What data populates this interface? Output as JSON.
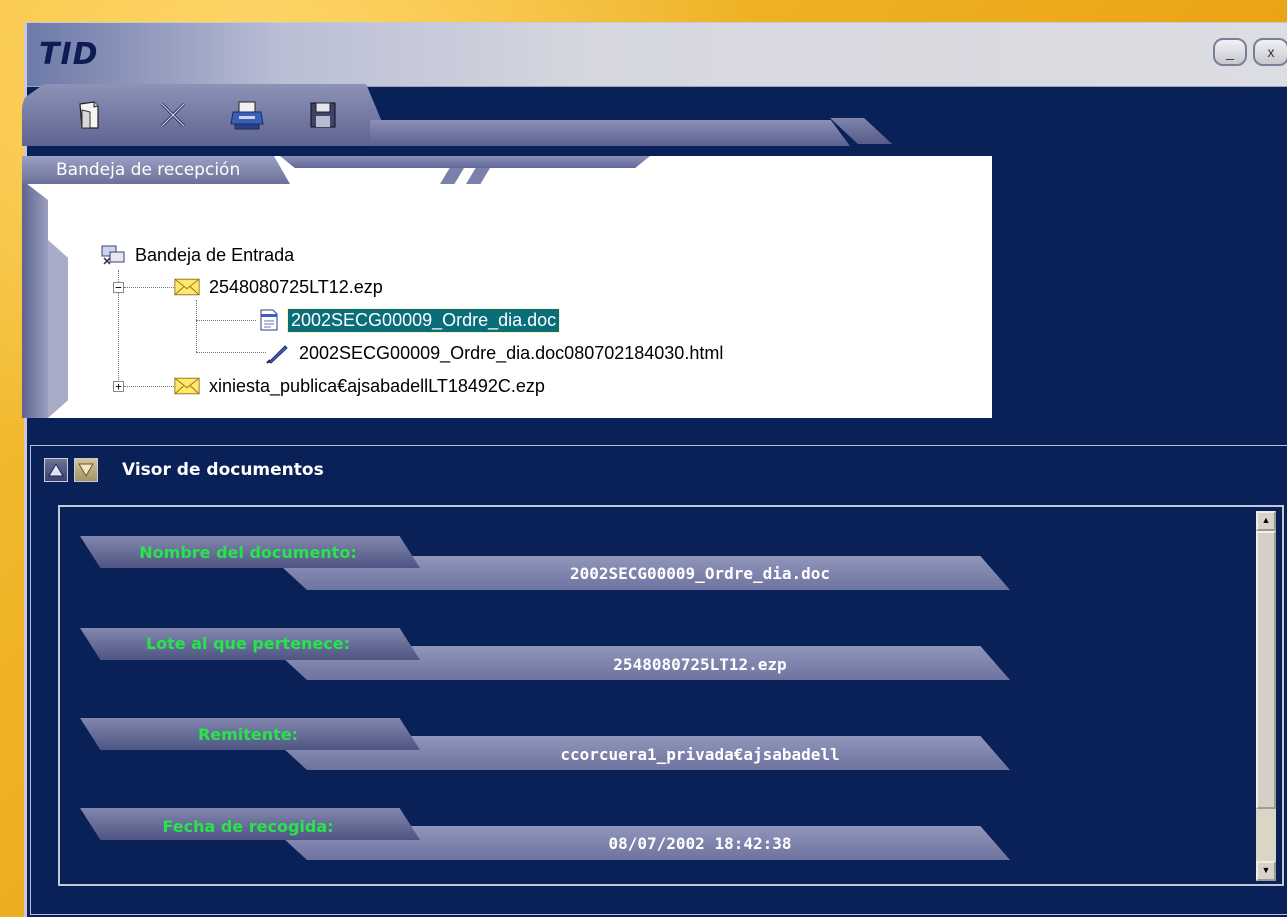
{
  "window": {
    "title": "TID",
    "minimize_label": "_",
    "close_label": "x"
  },
  "toolbar": {
    "items": [
      {
        "icon": "open-document-icon"
      },
      {
        "icon": "delete-icon"
      },
      {
        "icon": "print-icon"
      },
      {
        "icon": "save-icon"
      }
    ]
  },
  "inbox": {
    "tab_label": "Bandeja de recepción",
    "tree": {
      "root": {
        "label": "Bandeja de Entrada",
        "icon": "inbox-tray-icon"
      },
      "items": [
        {
          "label": "2548080725LT12.ezp",
          "icon": "envelope-icon",
          "expanded": true,
          "expander": "−"
        },
        {
          "label": "2002SECG00009_Ordre_dia.doc",
          "icon": "document-icon",
          "selected": true
        },
        {
          "label": "2002SECG00009_Ordre_dia.doc080702184030.html",
          "icon": "signature-pen-icon"
        },
        {
          "label": "xiniesta_publica€ajsabadellLT18492C.ezp",
          "icon": "envelope-icon",
          "expanded": false,
          "expander": "+"
        }
      ]
    }
  },
  "viewer": {
    "title": "Visor de documentos",
    "fields": [
      {
        "label": "Nombre del documento:",
        "value": "2002SECG00009_Ordre_dia.doc"
      },
      {
        "label": "Lote al que pertenece:",
        "value": "2548080725LT12.ezp"
      },
      {
        "label": "Remitente:",
        "value": "ccorcuera1_privada€ajsabadell"
      },
      {
        "label": "Fecha de recogida:",
        "value": "08/07/2002 18:42:38"
      }
    ]
  },
  "colors": {
    "window_bg": "#0a2157",
    "field_label": "#27e44b",
    "selection": "#0a6e79",
    "desktop": "#f2b320"
  }
}
